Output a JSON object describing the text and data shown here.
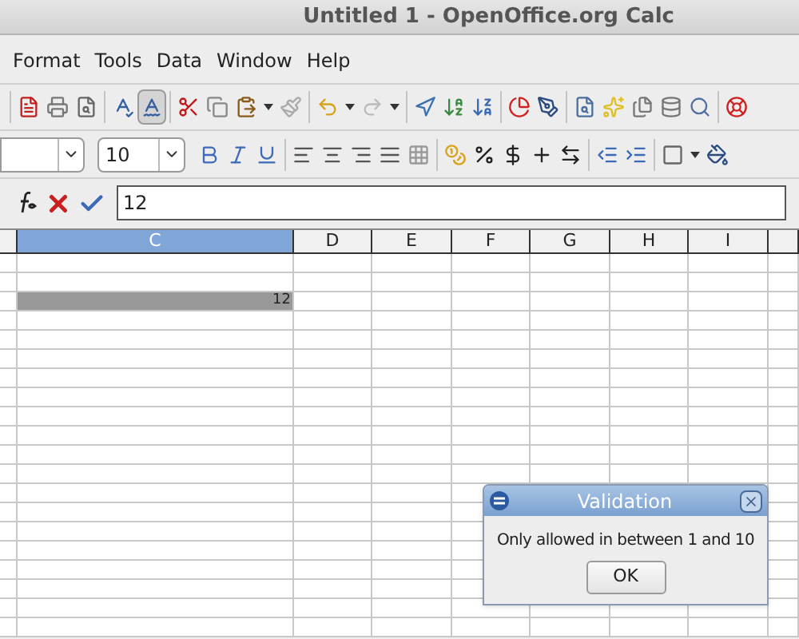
{
  "window": {
    "title": "Untitled 1 - OpenOffice.org Calc"
  },
  "menu": [
    "Format",
    "Tools",
    "Data",
    "Window",
    "Help"
  ],
  "standard_toolbar": {
    "autospellcheck_on": true
  },
  "formatting_toolbar": {
    "font_size": "10"
  },
  "formula_bar": {
    "value": "12"
  },
  "sheet": {
    "columns": [
      {
        "selected": false
      },
      {
        "label": "C",
        "selected": true
      },
      {
        "label": "D",
        "selected": false
      },
      {
        "label": "E",
        "selected": false
      },
      {
        "label": "F",
        "selected": false
      },
      {
        "label": "G",
        "selected": false
      },
      {
        "label": "H",
        "selected": false
      },
      {
        "label": "I",
        "selected": false
      },
      {
        "selected": false
      }
    ],
    "selected_cell_value": "12"
  },
  "dialog": {
    "title": "Validation",
    "message": "Only allowed in between 1 and 10",
    "button": "OK"
  }
}
